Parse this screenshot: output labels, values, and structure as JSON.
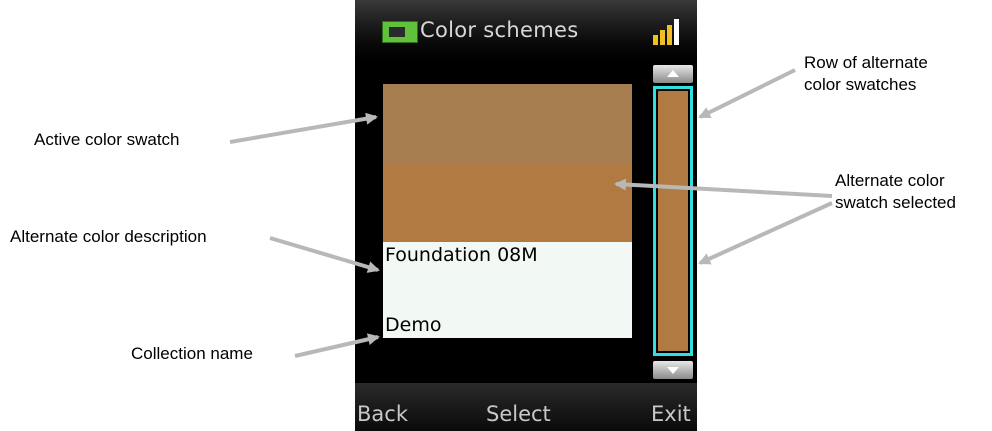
{
  "title_bar": {
    "title": "Color schemes",
    "app_icon": "app-icon",
    "signal_icon": "signal-strength-icon"
  },
  "swatches": {
    "active_color": "#a67d4f",
    "alternate_color": "#b27a43",
    "description": "Foundation 08M",
    "collection": "Demo"
  },
  "swatch_row": {
    "color": "#b27a43",
    "highlight_color": "#2ee0e0"
  },
  "softkeys": {
    "back": "Back",
    "select": "Select",
    "exit": "Exit"
  },
  "callouts": {
    "active_swatch": "Active color swatch",
    "alt_description": "Alternate color description",
    "collection_name": "Collection name",
    "row_line1": "Row of alternate",
    "row_line2": "color swatches",
    "selected_line1": "Alternate color",
    "selected_line2": "swatch selected"
  },
  "colors": {
    "arrow": "#b8b8b8",
    "signal": "#f0c020"
  }
}
